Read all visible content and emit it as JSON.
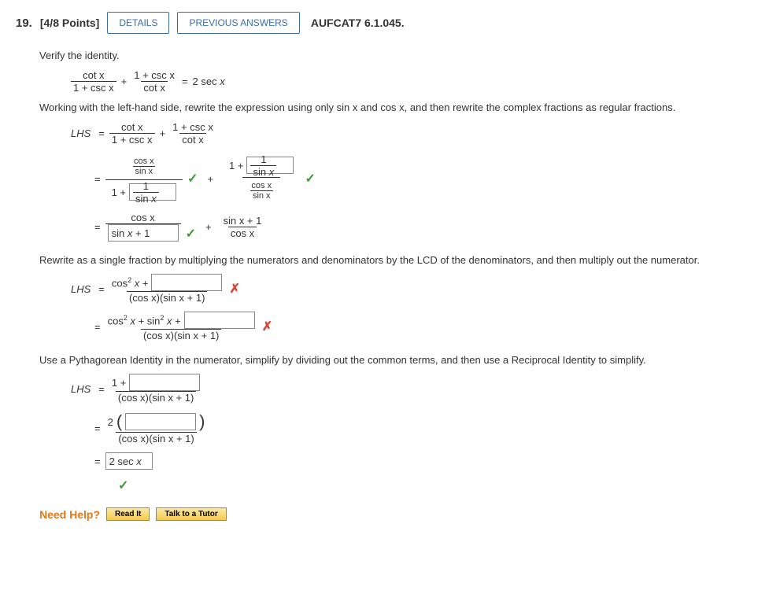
{
  "header": {
    "qnum": "19.",
    "points": "[4/8 Points]",
    "details_btn": "DETAILS",
    "prev_btn": "PREVIOUS ANSWERS",
    "ref": "AUFCAT7 6.1.045."
  },
  "lines": {
    "verify": "Verify the identity.",
    "identity_lhs_a_num": "cot x",
    "identity_lhs_a_den": "1 + csc x",
    "plus": "+",
    "identity_lhs_b_num": "1 + csc x",
    "identity_lhs_b_den": "cot x",
    "eq": "=",
    "identity_rhs": "2 sec x",
    "working": "Working with the left-hand side, rewrite the expression using only  sin x and cos x,  and then rewrite the complex fractions as regular fractions.",
    "lhs_label": "LHS",
    "step1_a_num": "cot x",
    "step1_a_den": "1 + csc x",
    "step1_b_num": "1 + csc x",
    "step1_b_den": "cot x",
    "cosx_sinx_num": "cos x",
    "cosx_sinx_den": "sin x",
    "one": "1",
    "one_plus": "1 +",
    "input_sinx": "sin x",
    "input_1_over_sinx_num": "1",
    "input_1_over_sinx_den": "sin x",
    "input_sinx_plus_1": "sin x + 1",
    "cosx": "cos x",
    "sinx_plus_1": "sin x + 1",
    "rewrite": "Rewrite as a single fraction by multiplying the numerators and denominators by the LCD of the denominators, and then multiply out the numerator.",
    "cos2x_plus": "cos² x +",
    "denom1": "(cos x)(sin x + 1)",
    "cos2_sin2_plus": "cos² x + sin² x +",
    "pythag": "Use a Pythagorean Identity in the numerator, simplify by dividing out the common terms, and then use a Reciprocal Identity to simplify.",
    "two": "2",
    "final_answer": "2 sec x"
  },
  "help": {
    "label": "Need Help?",
    "read": "Read It",
    "tutor": "Talk to a Tutor"
  }
}
